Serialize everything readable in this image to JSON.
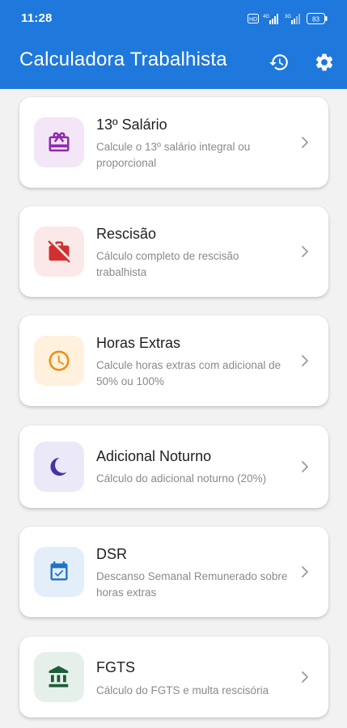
{
  "status_bar": {
    "time": "11:28",
    "battery": "83"
  },
  "app_bar": {
    "title": "Calculadora Trabalhista",
    "history_icon": "history-icon",
    "settings_icon": "gear-icon"
  },
  "calculators": [
    {
      "title": "13º Salário",
      "description": "Calcule o 13º salário integral ou proporcional",
      "icon": "gift-icon",
      "icon_color": "#8e2bb0",
      "tile_color": "#f3e6f6"
    },
    {
      "title": "Rescisão",
      "description": "Cálculo completo de rescisão trabalhista",
      "icon": "briefcase-off-icon",
      "icon_color": "#d32f2f",
      "tile_color": "#fbe9e9"
    },
    {
      "title": "Horas Extras",
      "description": "Calcule horas extras com adicional de 50% ou 100%",
      "icon": "clock-icon",
      "icon_color": "#ef8d0c",
      "tile_color": "#fff1de"
    },
    {
      "title": "Adicional Noturno",
      "description": "Cálculo do adicional noturno (20%)",
      "icon": "moon-icon",
      "icon_color": "#4b30a8",
      "tile_color": "#ebe8f7"
    },
    {
      "title": "DSR",
      "description": "Descanso Semanal Remunerado sobre horas extras",
      "icon": "calendar-check-icon",
      "icon_color": "#1f72c8",
      "tile_color": "#e3eef9"
    },
    {
      "title": "FGTS",
      "description": "Cálculo do FGTS e multa rescisória",
      "icon": "bank-icon",
      "icon_color": "#1b5e38",
      "tile_color": "#e6f0ea"
    }
  ]
}
